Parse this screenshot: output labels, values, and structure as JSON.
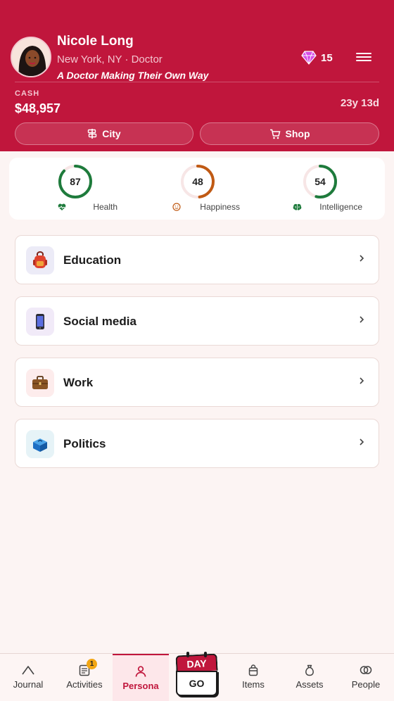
{
  "profile": {
    "name": "Nicole Long",
    "subtitle": "New York, NY · Doctor",
    "tagline": "A Doctor Making Their Own Way",
    "gems": "15",
    "cash_label": "CASH",
    "cash": "$48,957",
    "age": "23y 13d"
  },
  "header_buttons": {
    "city": "City",
    "shop": "Shop"
  },
  "stats": [
    {
      "label": "Health",
      "value": "87",
      "fraction": 0.87,
      "color": "#1e7b3c",
      "icon": "heartbeat-icon"
    },
    {
      "label": "Happiness",
      "value": "48",
      "fraction": 0.48,
      "color": "#c05a14",
      "icon": "smiley-icon"
    },
    {
      "label": "Intelligence",
      "value": "54",
      "fraction": 0.54,
      "color": "#1e7b3c",
      "icon": "brain-icon"
    }
  ],
  "categories": [
    {
      "title": "Education",
      "icon": "backpack-icon"
    },
    {
      "title": "Social media",
      "icon": "phone-icon"
    },
    {
      "title": "Work",
      "icon": "briefcase-icon"
    },
    {
      "title": "Politics",
      "icon": "ballot-box-icon"
    }
  ],
  "nav": {
    "journal": "Journal",
    "activities": "Activities",
    "activities_badge": "1",
    "persona": "Persona",
    "items": "Items",
    "assets": "Assets",
    "people": "People",
    "day_top": "DAY",
    "day_bottom": "GO"
  },
  "colors": {
    "brand": "#c0163c",
    "background": "#fcf4f3",
    "badge": "#f2a614"
  }
}
